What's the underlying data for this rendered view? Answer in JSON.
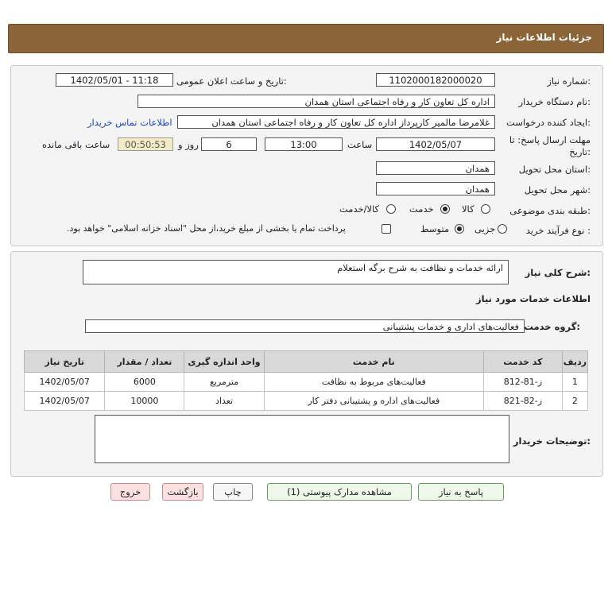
{
  "header": {
    "title": "جزئیات اطلاعات نیاز"
  },
  "form": {
    "need_number_label": "شماره نیاز:",
    "need_number": "1102000182000020",
    "announce_label": "تاریخ و ساعت اعلان عمومی:",
    "announce_value": "1402/05/01 - 11:18",
    "buyer_org_label": "نام دستگاه خریدار:",
    "buyer_org": "اداره کل تعاون  کار و رفاه اجتماعی استان همدان",
    "creator_label": "ایجاد کننده درخواست:",
    "creator": "غلامرضا مالمیر کارپرداز اداره کل تعاون  کار و رفاه اجتماعی استان همدان",
    "contact_link": "اطلاعات تماس خریدار",
    "deadline_label_1": "مهلت ارسال پاسخ: تا",
    "deadline_label_2": "تاریخ:",
    "deadline_date": "1402/05/07",
    "time_label": "ساعت",
    "deadline_time": "13:00",
    "days": "6",
    "days_label": "روز و",
    "remaining": "00:50:53",
    "remaining_label": "ساعت باقی مانده",
    "province_label": "استان محل تحویل:",
    "province": "همدان",
    "city_label": "شهر محل تحویل:",
    "city": "همدان",
    "category_label": "طبقه بندی موضوعی:",
    "category_options": [
      "کالا",
      "خدمت",
      "کالا/خدمت"
    ],
    "category_selected": "خدمت",
    "purchase_type_label": "نوع فرآیند خرید :",
    "purchase_options": [
      "جزیی",
      "متوسط"
    ],
    "purchase_selected": "متوسط",
    "payment_note": "پرداخت تمام یا بخشی از مبلغ خرید،از محل \"اسناد خزانه اسلامی\" خواهد بود."
  },
  "details": {
    "general_desc_label": "شرح کلی نیاز:",
    "general_desc": "ارائه خدمات و نظافت به شرح برگه استعلام",
    "services_info_title": "اطلاعات خدمات مورد نیاز",
    "service_group_label": "گروه خدمت:",
    "service_group": "فعالیت‌های اداری و خدمات پشتیبانی",
    "table": {
      "headers": [
        "ردیف",
        "کد خدمت",
        "نام خدمت",
        "واحد اندازه گیری",
        "تعداد / مقدار",
        "تاریخ نیاز"
      ],
      "rows": [
        [
          "1",
          "ز-81-812",
          "فعالیت‌های مربوط به نظافت",
          "مترمربع",
          "6000",
          "1402/05/07"
        ],
        [
          "2",
          "ز-82-821",
          "فعالیت‌های اداره و پشتیبانی دفتر کار",
          "تعداد",
          "10000",
          "1402/05/07"
        ]
      ]
    },
    "buyer_notes_label": "توضیحات خریدار:",
    "buyer_notes": ""
  },
  "buttons": {
    "reply": "پاسخ به نیاز",
    "attachments": "مشاهده مدارک پیوستی (1)",
    "print": "چاپ",
    "back": "بازگشت",
    "exit": "خروج"
  }
}
